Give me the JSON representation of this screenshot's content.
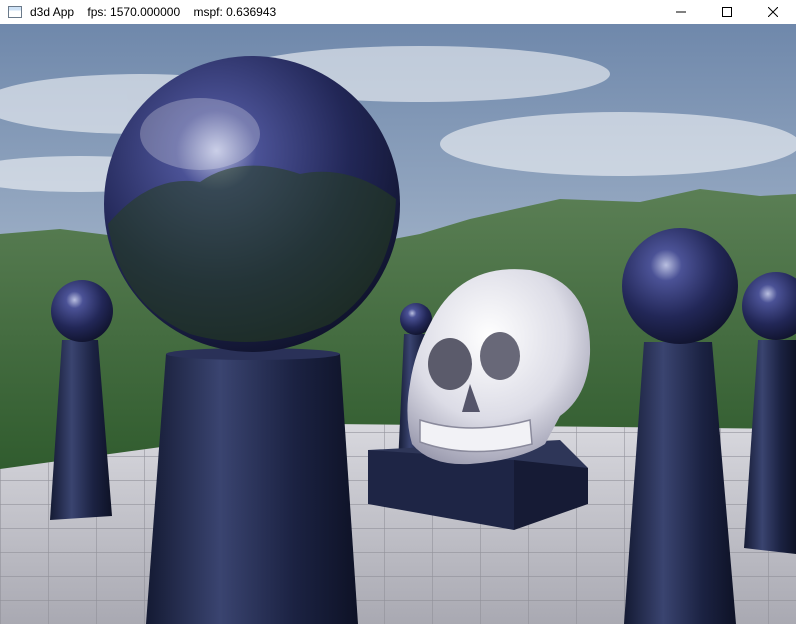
{
  "window": {
    "title": "d3d App    fps: 1570.000000    mspf: 0.636943",
    "controls": {
      "minimize_icon": "minimize-icon",
      "maximize_icon": "maximize-icon",
      "close_icon": "close-icon"
    }
  },
  "scene": {
    "description_icons": [
      "app-icon"
    ],
    "colors": {
      "sky_top": "#6f88ab",
      "sky_bottom": "#d9e1ea",
      "mountains": "#3d6a3c",
      "floor": "#c9c9cf",
      "pillar": "#1d2544",
      "sphere": "#2a2f6a",
      "skull": "#e8e8ee"
    }
  }
}
